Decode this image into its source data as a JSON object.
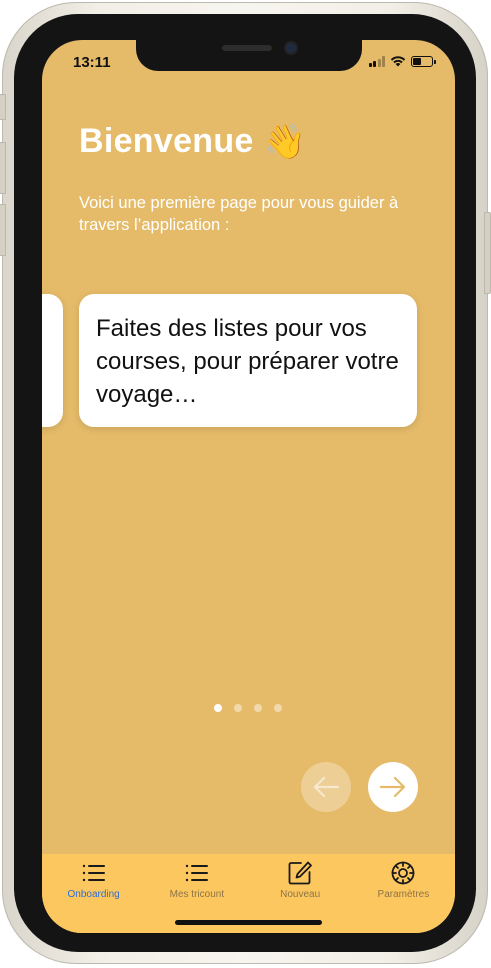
{
  "status_bar": {
    "time": "13:11"
  },
  "header": {
    "title": "Bienvenue",
    "title_emoji": "👋",
    "subtitle": "Voici une première page pour vous guider à travers l’application :"
  },
  "carousel": {
    "card_text": "Faites des listes pour vos courses, pour préparer votre voyage…",
    "page_count": 4,
    "current_page": 1
  },
  "navigation": {
    "prev_icon": "arrow-left-icon",
    "next_icon": "arrow-right-icon"
  },
  "tabbar": {
    "items": [
      {
        "label": "Onboarding",
        "icon": "list-icon",
        "active": true
      },
      {
        "label": "Mes tricount",
        "icon": "list-icon",
        "active": false
      },
      {
        "label": "Nouveau",
        "icon": "compose-icon",
        "active": false
      },
      {
        "label": "Paramètres",
        "icon": "gear-icon",
        "active": false
      }
    ]
  },
  "colors": {
    "background": "#e5bb69",
    "tabbar": "#fdc75f",
    "accent": "#2c6fd1",
    "text_light": "#ffffff"
  }
}
